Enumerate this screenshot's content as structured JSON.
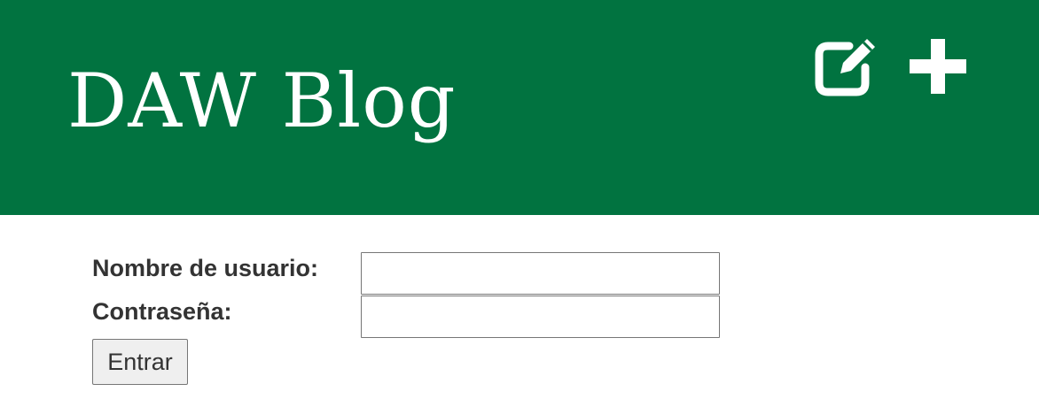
{
  "header": {
    "brand": "DAW Blog",
    "background_color": "#017340",
    "actions": [
      {
        "icon": "edit-icon",
        "label": "pencil-square"
      },
      {
        "icon": "plus-icon",
        "label": "plus"
      }
    ]
  },
  "login_form": {
    "username_label": "Nombre de usuario:",
    "username_value": "",
    "password_label": "Contraseña:",
    "password_value": "",
    "submit_label": "Entrar"
  }
}
